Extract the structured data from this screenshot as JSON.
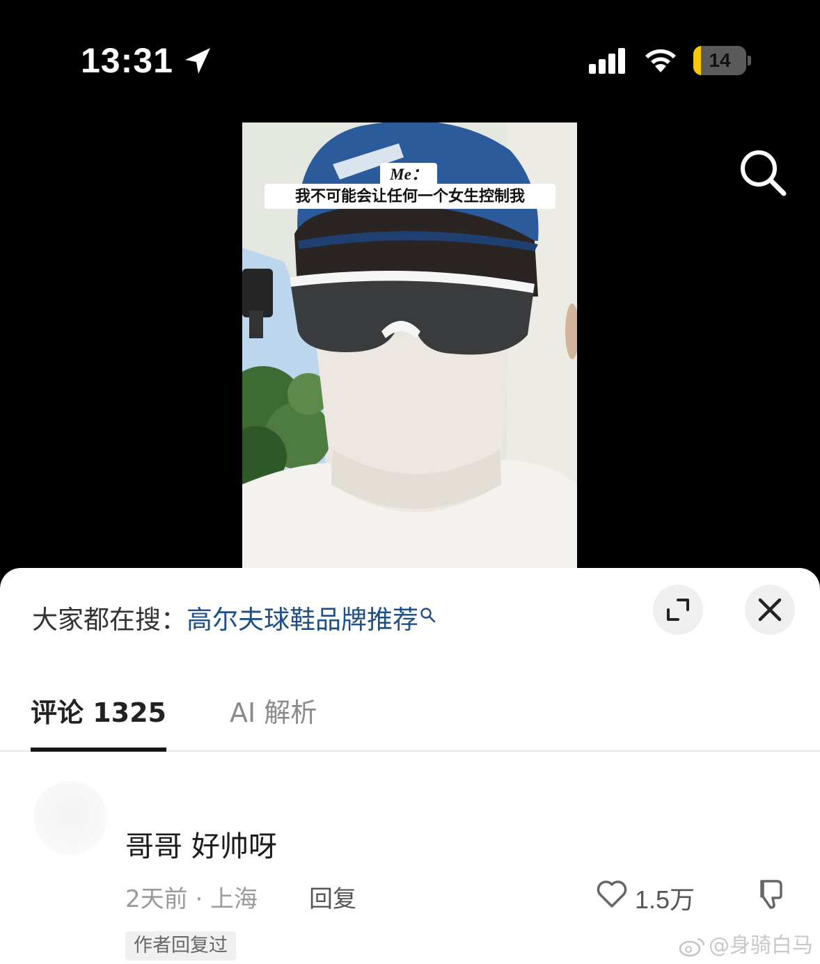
{
  "status_bar": {
    "time": "13:31",
    "battery_level": "14",
    "battery_fraction": 0.14,
    "icons": [
      "location-arrow-icon",
      "cellular-signal-icon",
      "wifi-icon",
      "battery-icon"
    ]
  },
  "video": {
    "caption_head": "Me：",
    "caption_text": "我不可能会让任何一个女生控制我",
    "search_icon": "search-icon"
  },
  "sheet": {
    "hot_search_label": "大家都在搜：",
    "hot_search_link": "高尔夫球鞋品牌推荐",
    "expand_icon": "expand-icon",
    "close_icon": "close-icon",
    "tabs": [
      {
        "label": "评论 1325",
        "active": true
      },
      {
        "label": "AI 解析",
        "active": false
      }
    ]
  },
  "comment": {
    "text": "哥哥 好帅呀",
    "meta": "2天前 · 上海",
    "reply_label": "回复",
    "likes": "1.5万",
    "author_badge": "作者回复过"
  },
  "watermark": {
    "text": "@身骑白马"
  },
  "colors": {
    "link": "#1f4f87",
    "battery_fill": "#f5c800",
    "sheet_bg": "#ffffff"
  }
}
